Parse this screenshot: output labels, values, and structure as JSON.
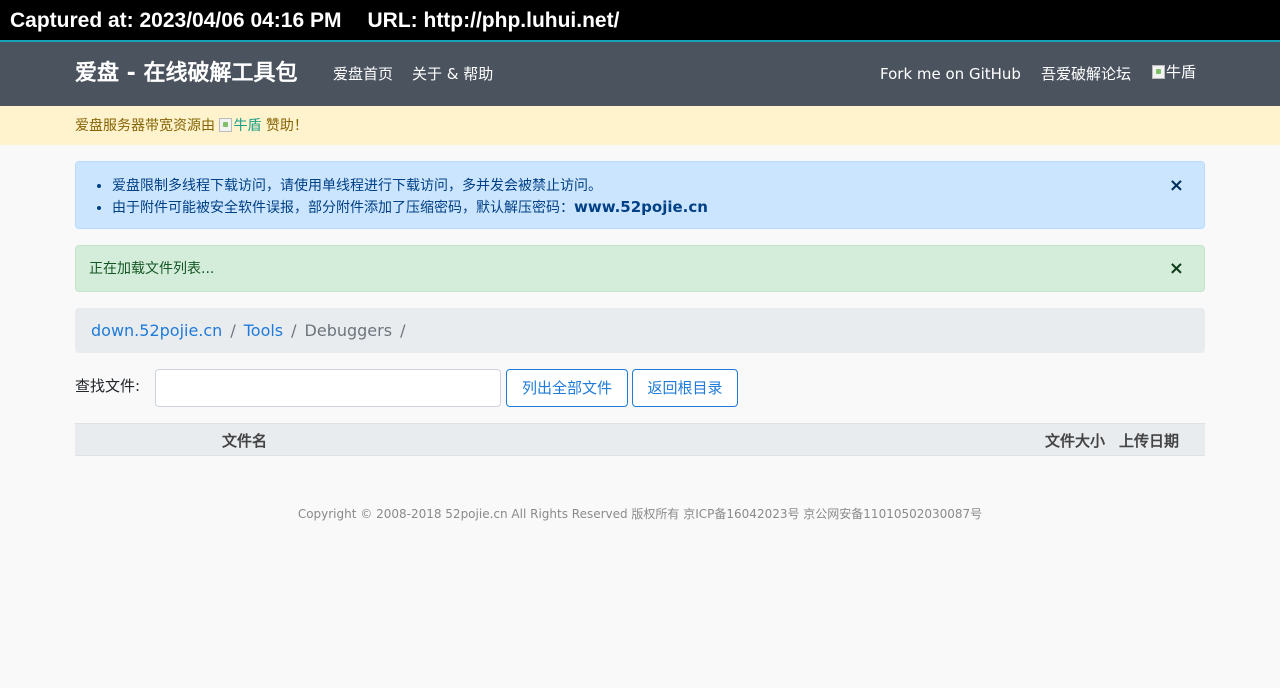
{
  "capture": {
    "captured_at": "Captured at: 2023/04/06 04:16 PM",
    "url": "URL: http://php.luhui.net/"
  },
  "navbar": {
    "brand": "爱盘 - 在线破解工具包",
    "links": [
      "爱盘首页",
      "关于 & 帮助"
    ],
    "right_links": [
      "Fork me on GitHub",
      "吾爱破解论坛"
    ],
    "image_alt": "牛盾"
  },
  "sponsor": {
    "prefix": "爱盘服务器带宽资源由",
    "image_alt": "牛盾",
    "suffix": "赞助！"
  },
  "info_alert": {
    "items": [
      "爱盘限制多线程下载访问，请使用单线程进行下载访问，多并发会被禁止访问。",
      "由于附件可能被安全软件误报，部分附件添加了压缩密码，默认解压密码："
    ],
    "password": "www.52pojie.cn",
    "close": "×"
  },
  "loading_alert": {
    "message": "正在加载文件列表...",
    "close": "×"
  },
  "breadcrumb": {
    "items": [
      "down.52pojie.cn",
      "Tools",
      "Debuggers"
    ],
    "separator": "/"
  },
  "search": {
    "label": "查找文件:",
    "value": "",
    "list_all_button": "列出全部文件",
    "back_root_button": "返回根目录"
  },
  "table": {
    "columns": [
      "文件名",
      "文件大小",
      "上传日期"
    ],
    "rows": []
  },
  "footer": {
    "copyright": "Copyright © 2008-2018 52pojie.cn All Rights Reserved 版权所有 京ICP备16042023号 京公网安备11010502030087号"
  },
  "colors": {
    "navbar_bg": "#4b535f",
    "accent_link": "#1e7bd9",
    "sponsor_bg": "#fff3cd",
    "info_bg": "#cce5ff",
    "success_bg": "#d4edda"
  }
}
